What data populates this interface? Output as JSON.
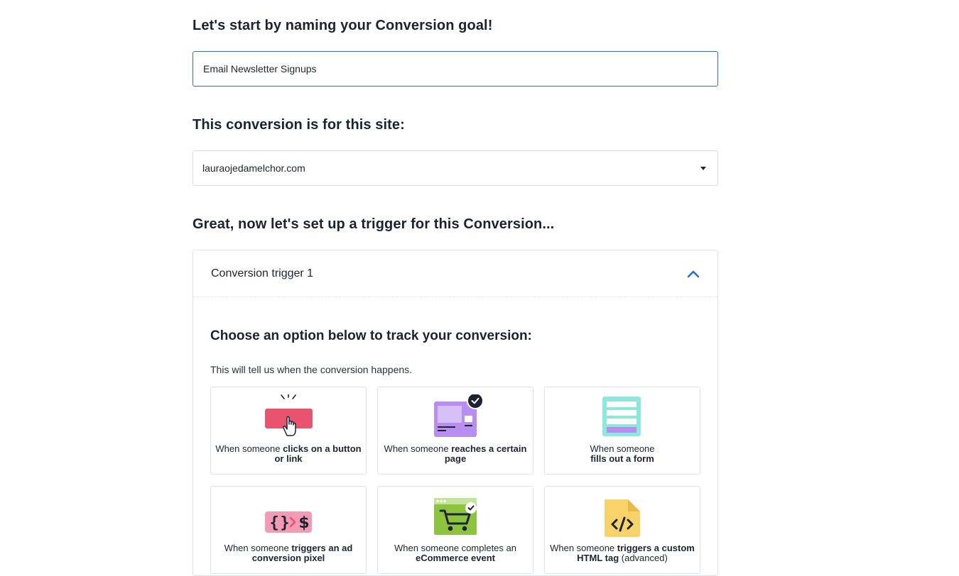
{
  "headings": {
    "goal": "Let's start by naming your Conversion goal!",
    "site": "This conversion is for this site:",
    "trigger": "Great, now let's set up a trigger for this Conversion..."
  },
  "goal_input": {
    "value": "Email Newsletter Signups"
  },
  "site_select": {
    "value": "lauraojedamelchor.com"
  },
  "trigger_panel": {
    "title": "Conversion trigger 1",
    "choose_heading": "Choose an option below to track your conversion:",
    "helper_text": "This will tell us when the conversion happens.",
    "options": [
      {
        "pre": "When someone ",
        "bold": "clicks on a button or link",
        "post": "",
        "icon": "button-click-icon"
      },
      {
        "pre": "When someone ",
        "bold": "reaches a certain page",
        "post": "",
        "icon": "page-reach-icon",
        "selected": true
      },
      {
        "pre": "When someone ",
        "bold": "fills out a form",
        "post": "",
        "icon": "form-icon"
      },
      {
        "pre": "When someone ",
        "bold": "triggers an ad conversion pixel",
        "post": "",
        "icon": "ad-pixel-icon"
      },
      {
        "pre": "When someone completes an ",
        "bold": "eCommerce event",
        "post": "",
        "icon": "ecommerce-cart-icon"
      },
      {
        "pre": "When someone ",
        "bold": "triggers a custom HTML tag",
        "post": " (advanced)",
        "icon": "html-tag-icon"
      }
    ]
  },
  "colors": {
    "accent": "#2f6bd7",
    "button_red": "#e8546f",
    "page_purple": "#b88ef0",
    "form_teal": "#8ee8dc",
    "pixel_pink": "#f39bb5",
    "cart_green": "#8cc43f",
    "html_yellow": "#f7d36a"
  }
}
